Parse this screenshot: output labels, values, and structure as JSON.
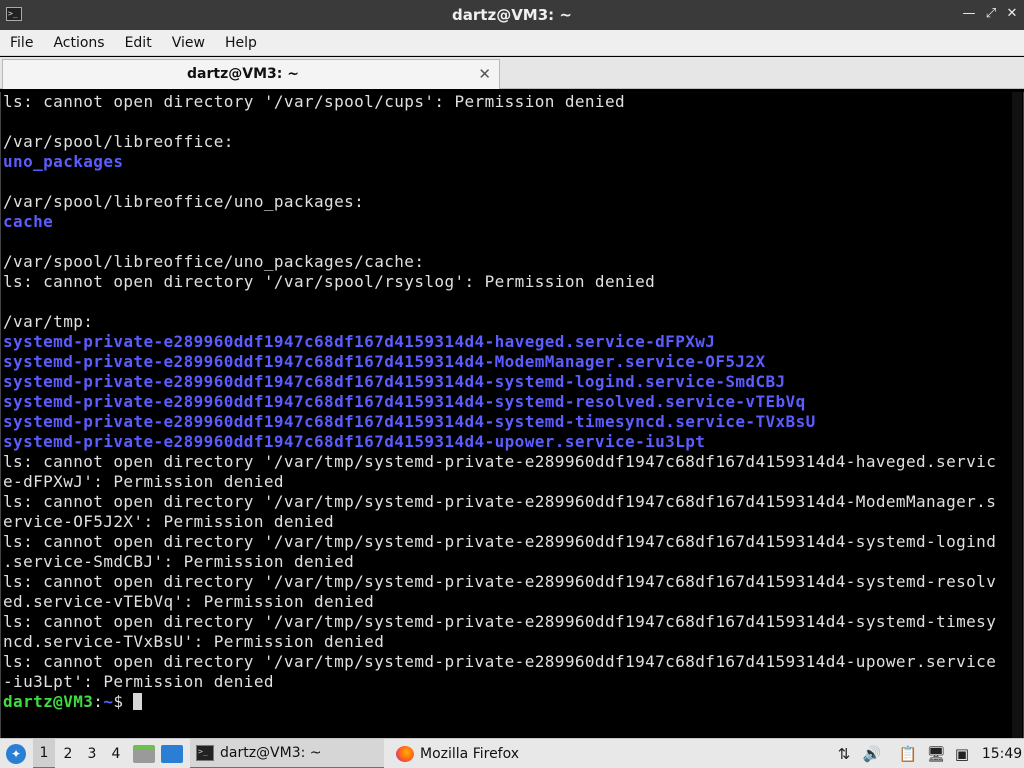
{
  "window": {
    "title": "dartz@VM3: ~",
    "controls": {
      "minimize": "—",
      "restore": "⤢",
      "close": "✕"
    }
  },
  "menu": {
    "items": [
      "File",
      "Actions",
      "Edit",
      "View",
      "Help"
    ]
  },
  "tab": {
    "label": "dartz@VM3: ~",
    "close": "✕"
  },
  "terminal": {
    "lines": [
      {
        "text": "ls: cannot open directory '/var/spool/cups': Permission denied",
        "type": "normal"
      },
      {
        "text": "",
        "type": "normal"
      },
      {
        "text": "/var/spool/libreoffice:",
        "type": "normal"
      },
      {
        "text": "uno_packages",
        "type": "dir"
      },
      {
        "text": "",
        "type": "normal"
      },
      {
        "text": "/var/spool/libreoffice/uno_packages:",
        "type": "normal"
      },
      {
        "text": "cache",
        "type": "dir"
      },
      {
        "text": "",
        "type": "normal"
      },
      {
        "text": "/var/spool/libreoffice/uno_packages/cache:",
        "type": "normal"
      },
      {
        "text": "ls: cannot open directory '/var/spool/rsyslog': Permission denied",
        "type": "normal"
      },
      {
        "text": "",
        "type": "normal"
      },
      {
        "text": "/var/tmp:",
        "type": "normal"
      },
      {
        "text": "systemd-private-e289960ddf1947c68df167d4159314d4-haveged.service-dFPXwJ",
        "type": "dir"
      },
      {
        "text": "systemd-private-e289960ddf1947c68df167d4159314d4-ModemManager.service-OF5J2X",
        "type": "dir"
      },
      {
        "text": "systemd-private-e289960ddf1947c68df167d4159314d4-systemd-logind.service-SmdCBJ",
        "type": "dir"
      },
      {
        "text": "systemd-private-e289960ddf1947c68df167d4159314d4-systemd-resolved.service-vTEbVq",
        "type": "dir"
      },
      {
        "text": "systemd-private-e289960ddf1947c68df167d4159314d4-systemd-timesyncd.service-TVxBsU",
        "type": "dir"
      },
      {
        "text": "systemd-private-e289960ddf1947c68df167d4159314d4-upower.service-iu3Lpt",
        "type": "dir"
      },
      {
        "text": "ls: cannot open directory '/var/tmp/systemd-private-e289960ddf1947c68df167d4159314d4-haveged.servic",
        "type": "normal"
      },
      {
        "text": "e-dFPXwJ': Permission denied",
        "type": "normal"
      },
      {
        "text": "ls: cannot open directory '/var/tmp/systemd-private-e289960ddf1947c68df167d4159314d4-ModemManager.s",
        "type": "normal"
      },
      {
        "text": "ervice-OF5J2X': Permission denied",
        "type": "normal"
      },
      {
        "text": "ls: cannot open directory '/var/tmp/systemd-private-e289960ddf1947c68df167d4159314d4-systemd-logind",
        "type": "normal"
      },
      {
        "text": ".service-SmdCBJ': Permission denied",
        "type": "normal"
      },
      {
        "text": "ls: cannot open directory '/var/tmp/systemd-private-e289960ddf1947c68df167d4159314d4-systemd-resolv",
        "type": "normal"
      },
      {
        "text": "ed.service-vTEbVq': Permission denied",
        "type": "normal"
      },
      {
        "text": "ls: cannot open directory '/var/tmp/systemd-private-e289960ddf1947c68df167d4159314d4-systemd-timesy",
        "type": "normal"
      },
      {
        "text": "ncd.service-TVxBsU': Permission denied",
        "type": "normal"
      },
      {
        "text": "ls: cannot open directory '/var/tmp/systemd-private-e289960ddf1947c68df167d4159314d4-upower.service",
        "type": "normal"
      },
      {
        "text": "-iu3Lpt': Permission denied",
        "type": "normal"
      }
    ],
    "prompt": {
      "user_host": "dartz@VM3",
      "sep": ":",
      "path": "~",
      "symbol": "$ "
    }
  },
  "taskbar": {
    "workspaces": [
      "1",
      "2",
      "3",
      "4"
    ],
    "tasks": [
      {
        "label": "dartz@VM3: ~",
        "icon": "terminal-icon"
      },
      {
        "label": "Mozilla Firefox",
        "icon": "firefox-icon"
      }
    ],
    "clock": "15:49"
  },
  "colors": {
    "terminal_bg": "#000000",
    "terminal_fg": "#e0e0e0",
    "directory": "#5c5cff",
    "prompt_user": "#3fdc3f",
    "taskbar_accent": "#2a7fd4"
  }
}
